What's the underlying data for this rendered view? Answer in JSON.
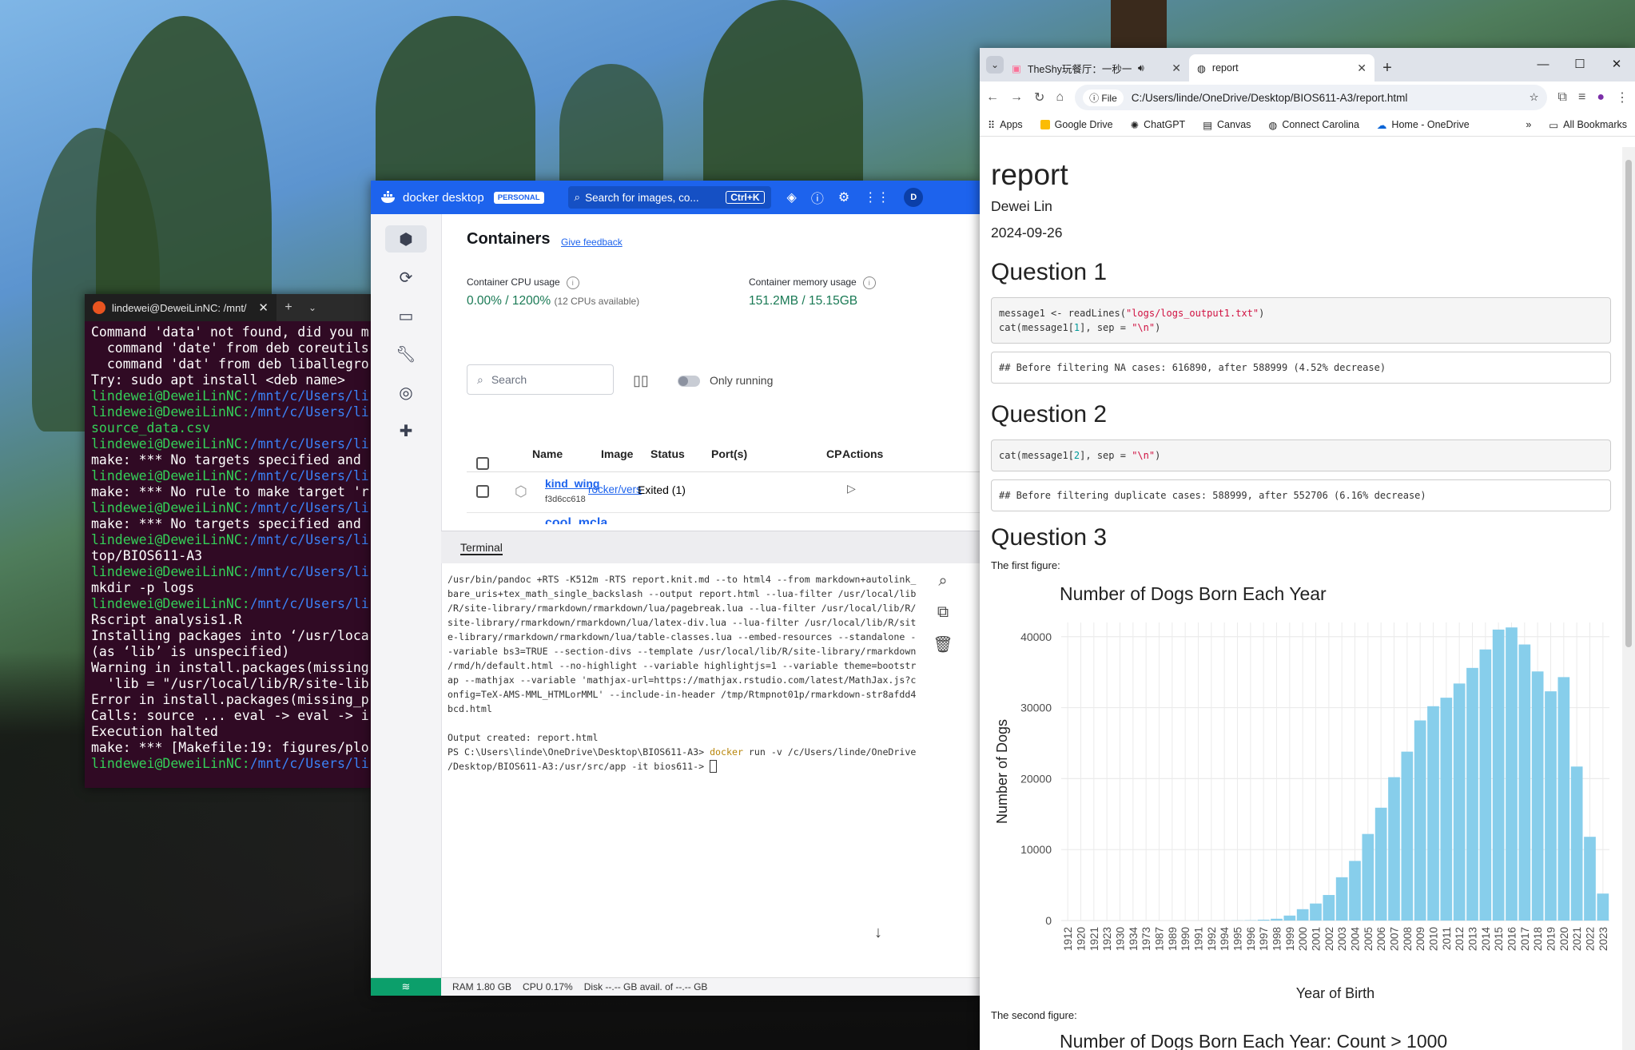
{
  "terminal": {
    "tab_title": "lindewei@DeweiLinNC: /mnt/",
    "lines": [
      {
        "t": "Command 'data' not found, did you m"
      },
      {
        "t": "  command 'date' from deb coreutils"
      },
      {
        "t": "  command 'dat' from deb liballegro"
      },
      {
        "t": "Try: sudo apt install <deb name>"
      },
      {
        "u": "lindewei@DeweiLinNC",
        "p": "/mnt/c/Users/li"
      },
      {
        "u": "lindewei@DeweiLinNC",
        "p": "/mnt/c/Users/li"
      },
      {
        "t": "source_data.csv",
        "green": true
      },
      {
        "u": "lindewei@DeweiLinNC",
        "p": "/mnt/c/Users/li"
      },
      {
        "t": "make: *** No targets specified and"
      },
      {
        "u": "lindewei@DeweiLinNC",
        "p": "/mnt/c/Users/li"
      },
      {
        "t": "make: *** No rule to make target 'r"
      },
      {
        "u": "lindewei@DeweiLinNC",
        "p": "/mnt/c/Users/li"
      },
      {
        "t": "make: *** No targets specified and"
      },
      {
        "u": "lindewei@DeweiLinNC",
        "p": "/mnt/c/Users/li"
      },
      {
        "t": "top/BIOS611-A3"
      },
      {
        "u": "lindewei@DeweiLinNC",
        "p": "/mnt/c/Users/li"
      },
      {
        "t": "mkdir -p logs"
      },
      {
        "u": "lindewei@DeweiLinNC",
        "p": "/mnt/c/Users/li"
      },
      {
        "t": "Rscript analysis1.R"
      },
      {
        "t": "Installing packages into ‘/usr/loca"
      },
      {
        "t": "(as ‘lib’ is unspecified)"
      },
      {
        "t": "Warning in install.packages(missing"
      },
      {
        "t": "  'lib = \"/usr/local/lib/R/site-lib"
      },
      {
        "t": "Error in install.packages(missing_p"
      },
      {
        "t": "Calls: source ... eval -> eval -> i"
      },
      {
        "t": "Execution halted"
      },
      {
        "t": "make: *** [Makefile:19: figures/plo"
      },
      {
        "u": "lindewei@DeweiLinNC",
        "p": "/mnt/c/Users/li"
      }
    ]
  },
  "docker": {
    "brand": "docker desktop",
    "badge": "PERSONAL",
    "search_placeholder": "Search for images, co...",
    "shortcut": "Ctrl+K",
    "avatar": "D",
    "page_title": "Containers",
    "feedback": "Give feedback",
    "cpu_label": "Container CPU usage",
    "cpu_value": "0.00% / 1200%",
    "cpu_note": "(12 CPUs available)",
    "mem_label": "Container memory usage",
    "mem_value": "151.2MB / 15.15GB",
    "show_charts": "S",
    "search_label": "Search",
    "only_running": "Only running",
    "columns": [
      "Name",
      "Image",
      "Status",
      "Port(s)",
      "CP",
      "Actions"
    ],
    "rows": [
      {
        "name": "kind_wing",
        "id": "f3d6cc618",
        "image": "rocker/vers",
        "status": "Exited (1)"
      },
      {
        "name": "cool_mcla",
        "id": "",
        "image": "",
        "status": ""
      }
    ],
    "terminal_tab": "Terminal",
    "terminal_lines": [
      "/usr/bin/pandoc +RTS -K512m -RTS report.knit.md --to html4 --from markdown+autolink_",
      "bare_uris+tex_math_single_backslash --output report.html --lua-filter /usr/local/lib",
      "/R/site-library/rmarkdown/rmarkdown/lua/pagebreak.lua --lua-filter /usr/local/lib/R/",
      "site-library/rmarkdown/rmarkdown/lua/latex-div.lua --lua-filter /usr/local/lib/R/sit",
      "e-library/rmarkdown/rmarkdown/lua/table-classes.lua --embed-resources --standalone -",
      "-variable bs3=TRUE --section-divs --template /usr/local/lib/R/site-library/rmarkdown",
      "/rmd/h/default.html --no-highlight --variable highlightjs=1 --variable theme=bootstr",
      "ap --mathjax --variable 'mathjax-url=https://mathjax.rstudio.com/latest/MathJax.js?c",
      "onfig=TeX-AMS-MML_HTMLorMML' --include-in-header /tmp/Rtmpnot01p/rmarkdown-str8afdd4",
      "bcd.html",
      "",
      "Output created: report.html"
    ],
    "ps_prompt": "PS C:\\Users\\linde\\OneDrive\\Desktop\\BIOS611-A3> ",
    "ps_cmd": "docker",
    "ps_rest1": " run -v /c/Users/linde/OneDrive",
    "ps_line2": "/Desktop/BIOS611-A3:/usr/src/app -it bios611-> ",
    "status_ram": "RAM 1.80 GB",
    "status_cpu": "CPU 0.17%",
    "status_disk": "Disk --.-- GB avail. of --.-- GB"
  },
  "chrome": {
    "tab1_title": "TheShy玩餐厅：一秒一个",
    "tab2_title": "report",
    "file_chip": "File",
    "url": "C:/Users/linde/OneDrive/Desktop/BIOS611-A3/report.html",
    "bookmarks": [
      "Apps",
      "Google Drive",
      "ChatGPT",
      "Canvas",
      "Connect Carolina",
      "Home - OneDrive"
    ],
    "all_bookmarks": "All Bookmarks"
  },
  "report": {
    "title": "report",
    "author": "Dewei Lin",
    "date": "2024-09-26",
    "q1": "Question 1",
    "q1_code_1_a": "message1 <- readLines(",
    "q1_code_1_s": "\"logs/logs_output1.txt\"",
    "q1_code_1_b": ")",
    "q1_code_2_a": "cat(message1[",
    "q1_code_2_n": "1",
    "q1_code_2_b": "], sep = ",
    "q1_code_2_s": "\"\\n\"",
    "q1_code_2_c": ")",
    "q1_out": "## Before filtering NA cases: 616890, after 588999 (4.52% decrease)",
    "q2": "Question 2",
    "q2_code_a": "cat(message1[",
    "q2_code_n": "2",
    "q2_code_b": "], sep = ",
    "q2_code_s": "\"\\n\"",
    "q2_code_c": ")",
    "q2_out": "## Before filtering duplicate cases: 588999, after 552706 (6.16% decrease)",
    "q3": "Question 3",
    "first_fig": "The first figure:",
    "second_fig": "The second figure:",
    "second_fig_title": "Number of Dogs Born Each Year: Count > 1000"
  },
  "chart_data": {
    "type": "bar",
    "title": "Number of Dogs Born Each Year",
    "xlabel": "Year of Birth",
    "ylabel": "Number of Dogs",
    "ylim": [
      0,
      42000
    ],
    "yticks": [
      0,
      10000,
      20000,
      30000,
      40000
    ],
    "grid": true,
    "color": "#87ceeb",
    "categories": [
      "1912",
      "1920",
      "1921",
      "1923",
      "1930",
      "1934",
      "1973",
      "1987",
      "1989",
      "1990",
      "1991",
      "1992",
      "1994",
      "1995",
      "1996",
      "1997",
      "1998",
      "1999",
      "2000",
      "2001",
      "2002",
      "2003",
      "2004",
      "2005",
      "2006",
      "2007",
      "2008",
      "2009",
      "2010",
      "2011",
      "2012",
      "2013",
      "2014",
      "2015",
      "2016",
      "2017",
      "2018",
      "2019",
      "2020",
      "2021",
      "2022",
      "2023"
    ],
    "values": [
      1,
      1,
      1,
      1,
      1,
      1,
      1,
      1,
      1,
      1,
      2,
      5,
      10,
      20,
      40,
      120,
      250,
      700,
      1600,
      2400,
      3600,
      6100,
      8400,
      12200,
      15900,
      20200,
      23800,
      28200,
      30200,
      31400,
      33400,
      35600,
      38200,
      41000,
      41300,
      38900,
      35100,
      32300,
      34300,
      21700,
      11800,
      3800
    ]
  }
}
